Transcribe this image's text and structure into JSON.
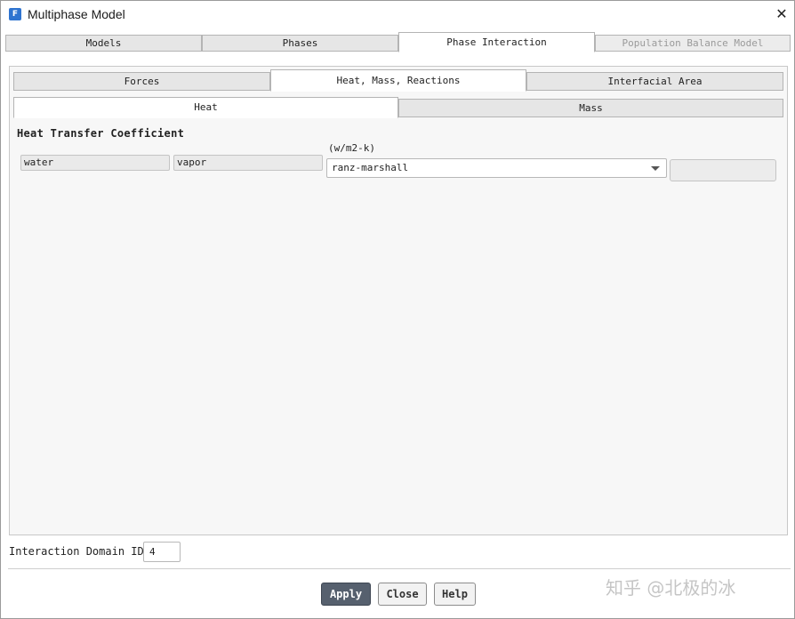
{
  "window": {
    "title": "Multiphase Model",
    "app_icon_letter": "F"
  },
  "top_tabs": [
    {
      "label": "Models",
      "state": "normal"
    },
    {
      "label": "Phases",
      "state": "normal"
    },
    {
      "label": "Phase Interaction",
      "state": "active"
    },
    {
      "label": "Population Balance Model",
      "state": "disabled"
    }
  ],
  "sub_tabs": [
    {
      "label": "Forces",
      "state": "normal"
    },
    {
      "label": "Heat, Mass, Reactions",
      "state": "active"
    },
    {
      "label": "Interfacial Area",
      "state": "normal"
    }
  ],
  "inner_tabs": [
    {
      "label": "Heat",
      "state": "active"
    },
    {
      "label": "Mass",
      "state": "normal"
    }
  ],
  "heat": {
    "section_title": "Heat Transfer Coefficient",
    "unit": "(w/m2-k)",
    "phase_1": "water",
    "phase_2": "vapor",
    "method": "ranz-marshall"
  },
  "domain": {
    "label": "Interaction Domain ID",
    "value": "4"
  },
  "buttons": {
    "apply": "Apply",
    "close": "Close",
    "help": "Help"
  },
  "watermark": "知乎 @北极的冰",
  "colors": {
    "primary_button": "#56606e",
    "app_icon": "#2f74d0"
  },
  "icons": {
    "app": "fluent-app-icon",
    "close": "close-icon",
    "dropdown": "chevron-down-icon"
  }
}
